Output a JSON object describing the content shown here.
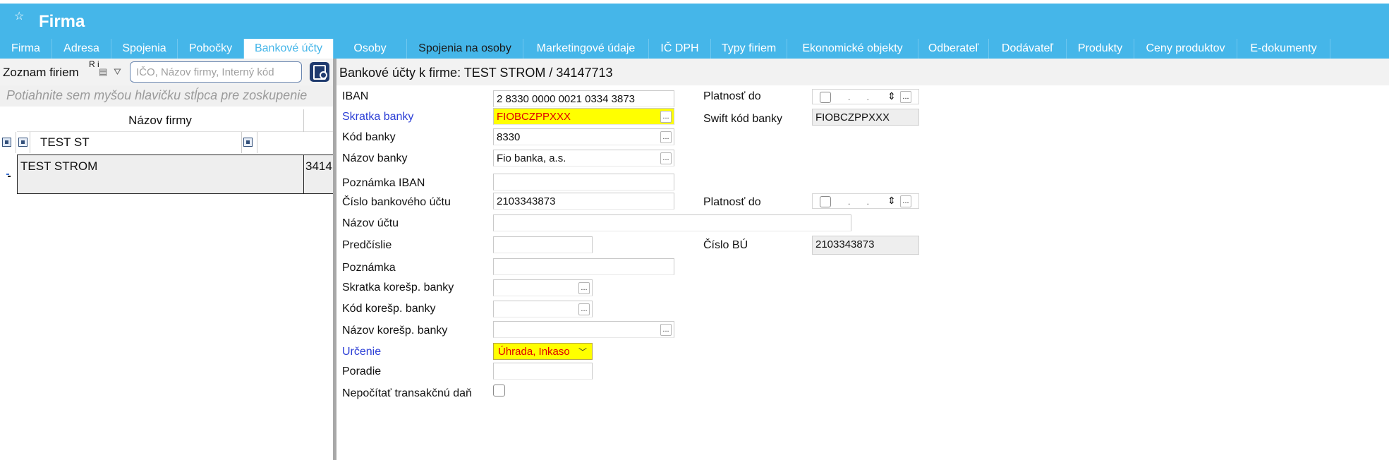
{
  "window": {
    "title": "Firma",
    "star_icon": "star-icon"
  },
  "tabs": [
    {
      "label": "Firma"
    },
    {
      "label": "Adresa"
    },
    {
      "label": "Spojenia"
    },
    {
      "label": "Pobočky"
    },
    {
      "label": "Bankové účty",
      "active": true
    },
    {
      "label": "Osoby"
    },
    {
      "label": "Spojenia na osoby"
    },
    {
      "label": "Marketingové údaje"
    },
    {
      "label": "IČ DPH"
    },
    {
      "label": "Typy firiem"
    },
    {
      "label": "Ekonomické objekty"
    },
    {
      "label": "Odberateľ"
    },
    {
      "label": "Dodávateľ"
    },
    {
      "label": "Produkty"
    },
    {
      "label": "Ceny produktov"
    },
    {
      "label": "E-dokumenty"
    }
  ],
  "left": {
    "title": "Zoznam firiem",
    "tiny_text": "R i",
    "search_placeholder": "IČO, Názov firmy, Interný kód",
    "group_hint": "Potiahnite sem myšou hlavičku stĺpca pre zoskupenie",
    "column_header": "Názov firmy",
    "filter_value": "TEST ST",
    "rows": [
      {
        "name": "TEST STROM",
        "code": "3414"
      }
    ]
  },
  "right": {
    "header": "Bankové účty k firme: TEST STROM / 34147713",
    "fields": {
      "iban": {
        "label": "IBAN",
        "value": "2 8330 0000 0021 0334 3873"
      },
      "platnost_do_1": {
        "label": "Platnosť do"
      },
      "skratka_banky": {
        "label": "Skratka banky",
        "value": "FIOBCZPPXXX"
      },
      "swift": {
        "label": "Swift kód banky",
        "value": "FIOBCZPPXXX"
      },
      "kod_banky": {
        "label": "Kód banky",
        "value": "8330"
      },
      "nazov_banky": {
        "label": "Názov banky",
        "value": "Fio banka, a.s."
      },
      "poznamka_iban": {
        "label": "Poznámka IBAN",
        "value": ""
      },
      "cislo_uctu": {
        "label": "Číslo bankového účtu",
        "value": "2103343873"
      },
      "platnost_do_2": {
        "label": "Platnosť do"
      },
      "nazov_uctu": {
        "label": "Názov účtu",
        "value": ""
      },
      "predcislie": {
        "label": "Predčíslie",
        "value": ""
      },
      "cislo_bu": {
        "label": "Číslo BÚ",
        "value": "2103343873"
      },
      "poznamka": {
        "label": "Poznámka",
        "value": ""
      },
      "skratka_koresp": {
        "label": "Skratka korešp. banky",
        "value": ""
      },
      "kod_koresp": {
        "label": "Kód korešp. banky",
        "value": ""
      },
      "nazov_koresp": {
        "label": "Názov korešp. banky",
        "value": ""
      },
      "urcenie": {
        "label": "Určenie",
        "value": "Úhrada, Inkaso"
      },
      "poradie": {
        "label": "Poradie",
        "value": ""
      },
      "transakcna_dan": {
        "label": "Nepočítať transakčnú daň",
        "checked": false
      }
    },
    "date_placeholder": ". .",
    "dots": "...",
    "spin": "⇕"
  },
  "colors": {
    "accent": "#45b6e9",
    "highlight": "#ffff00",
    "required_label": "#2b3ed6",
    "error_text": "#e00000"
  }
}
